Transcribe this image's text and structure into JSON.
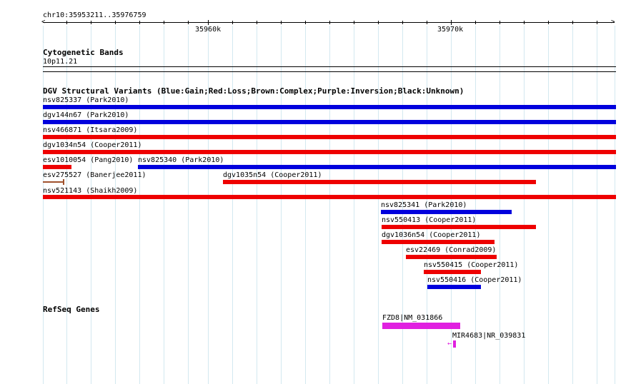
{
  "ruler": {
    "region": "chr10:35953211..35976759",
    "ticks": [
      "35960k",
      "35970k"
    ]
  },
  "cytoband": {
    "title": "Cytogenetic Bands",
    "band": "10p11.21"
  },
  "dgv": {
    "title": "DGV Structural Variants (Blue:Gain;Red:Loss;Brown:Complex;Purple:Inversion;Black:Unknown)",
    "colors": {
      "gain": "#0000dd",
      "loss": "#ee0000",
      "complex": "#a0522d",
      "inversion": "#800080",
      "unknown": "#000000"
    },
    "variants": [
      {
        "label": "nsv825337 (Park2010)"
      },
      {
        "label": "dgv144n67 (Park2010)"
      },
      {
        "label": "nsv466871 (Itsara2009)"
      },
      {
        "label": "dgv1034n54 (Cooper2011)"
      },
      {
        "label": "esv1010054 (Pang2010)"
      },
      {
        "label": "nsv825340 (Park2010)"
      },
      {
        "label": "esv275527 (Banerjee2011)"
      },
      {
        "label": "dgv1035n54 (Cooper2011)"
      },
      {
        "label": "nsv521143 (Shaikh2009)"
      },
      {
        "label": "nsv825341 (Park2010)"
      },
      {
        "label": "nsv550413 (Cooper2011)"
      },
      {
        "label": "dgv1036n54 (Cooper2011)"
      },
      {
        "label": "esv22469 (Conrad2009)"
      },
      {
        "label": "nsv550415 (Cooper2011)"
      },
      {
        "label": "nsv550416 (Cooper2011)"
      }
    ]
  },
  "refseq": {
    "title": "RefSeq Genes",
    "color": "#e020e0",
    "genes": [
      {
        "label": "FZD8|NM_031866"
      },
      {
        "label": "MIR4683|NR_039831"
      }
    ]
  }
}
